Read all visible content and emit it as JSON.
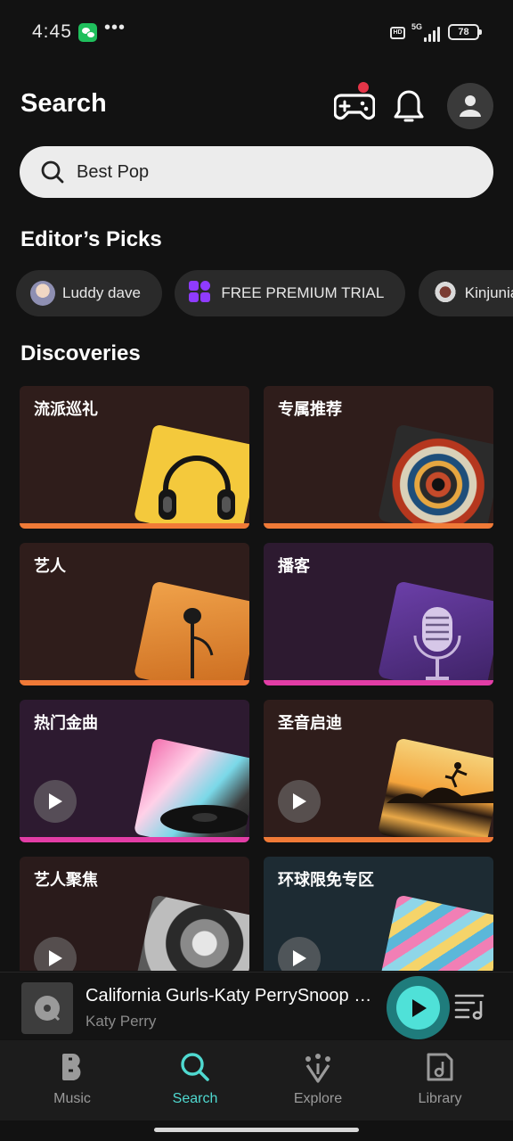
{
  "status_bar": {
    "time": "4:45",
    "dots": "•••",
    "hd": "HD",
    "network": "5G",
    "battery": "78"
  },
  "header": {
    "title": "Search"
  },
  "search": {
    "value": "Best Pop"
  },
  "editors_picks": {
    "title": "Editor’s Picks",
    "chips": [
      {
        "label": "Luddy dave"
      },
      {
        "label": "FREE PREMIUM TRIAL"
      },
      {
        "label": "Kinjunia"
      }
    ]
  },
  "discoveries": {
    "title": "Discoveries",
    "cards": [
      {
        "title": "流派巡礼",
        "bg": "#2f1d1b",
        "bar": "#f07a37",
        "play": false
      },
      {
        "title": "专属推荐",
        "bg": "#2f1d1b",
        "bar": "#f07a37",
        "play": false
      },
      {
        "title": "艺人",
        "bg": "#2f1d1b",
        "bar": "#f07a37",
        "play": false
      },
      {
        "title": "播客",
        "bg": "#2d1a30",
        "bar": "#e23da6",
        "play": false
      },
      {
        "title": "热门金曲",
        "bg": "#2d1a30",
        "bar": "#e23da6",
        "play": true
      },
      {
        "title": "圣音启迪",
        "bg": "#2f1d1b",
        "bar": "#f07a37",
        "play": true
      },
      {
        "title": "艺人聚焦",
        "bg": "#2a1b1b",
        "bar": "#f07a37",
        "play": true
      },
      {
        "title": "环球限免专区",
        "bg": "#1d2b33",
        "bar": "#3ab0c8",
        "play": true
      }
    ]
  },
  "mini_player": {
    "title": "California Gurls-Katy PerrySnoop Dogg",
    "artist": "Katy Perry"
  },
  "nav": {
    "items": [
      {
        "label": "Music",
        "icon": "music-logo-icon"
      },
      {
        "label": "Search",
        "icon": "search-icon"
      },
      {
        "label": "Explore",
        "icon": "explore-icon"
      },
      {
        "label": "Library",
        "icon": "library-icon"
      }
    ],
    "active": "Search"
  },
  "colors": {
    "accent": "#4fd9d0",
    "background": "#121212",
    "notification": "#e53548"
  }
}
